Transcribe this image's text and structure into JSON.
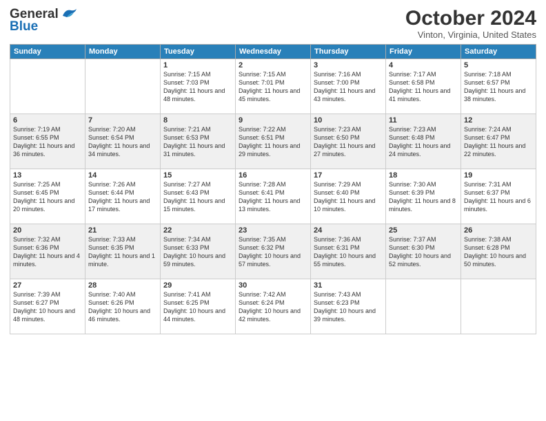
{
  "header": {
    "logo": {
      "general": "General",
      "blue": "Blue"
    },
    "title": "October 2024",
    "location": "Vinton, Virginia, United States"
  },
  "days_of_week": [
    "Sunday",
    "Monday",
    "Tuesday",
    "Wednesday",
    "Thursday",
    "Friday",
    "Saturday"
  ],
  "weeks": [
    [
      {
        "day": "",
        "info": ""
      },
      {
        "day": "",
        "info": ""
      },
      {
        "day": "1",
        "info": "Sunrise: 7:15 AM\nSunset: 7:03 PM\nDaylight: 11 hours\nand 48 minutes."
      },
      {
        "day": "2",
        "info": "Sunrise: 7:15 AM\nSunset: 7:01 PM\nDaylight: 11 hours\nand 45 minutes."
      },
      {
        "day": "3",
        "info": "Sunrise: 7:16 AM\nSunset: 7:00 PM\nDaylight: 11 hours\nand 43 minutes."
      },
      {
        "day": "4",
        "info": "Sunrise: 7:17 AM\nSunset: 6:58 PM\nDaylight: 11 hours\nand 41 minutes."
      },
      {
        "day": "5",
        "info": "Sunrise: 7:18 AM\nSunset: 6:57 PM\nDaylight: 11 hours\nand 38 minutes."
      }
    ],
    [
      {
        "day": "6",
        "info": "Sunrise: 7:19 AM\nSunset: 6:55 PM\nDaylight: 11 hours\nand 36 minutes."
      },
      {
        "day": "7",
        "info": "Sunrise: 7:20 AM\nSunset: 6:54 PM\nDaylight: 11 hours\nand 34 minutes."
      },
      {
        "day": "8",
        "info": "Sunrise: 7:21 AM\nSunset: 6:53 PM\nDaylight: 11 hours\nand 31 minutes."
      },
      {
        "day": "9",
        "info": "Sunrise: 7:22 AM\nSunset: 6:51 PM\nDaylight: 11 hours\nand 29 minutes."
      },
      {
        "day": "10",
        "info": "Sunrise: 7:23 AM\nSunset: 6:50 PM\nDaylight: 11 hours\nand 27 minutes."
      },
      {
        "day": "11",
        "info": "Sunrise: 7:23 AM\nSunset: 6:48 PM\nDaylight: 11 hours\nand 24 minutes."
      },
      {
        "day": "12",
        "info": "Sunrise: 7:24 AM\nSunset: 6:47 PM\nDaylight: 11 hours\nand 22 minutes."
      }
    ],
    [
      {
        "day": "13",
        "info": "Sunrise: 7:25 AM\nSunset: 6:45 PM\nDaylight: 11 hours\nand 20 minutes."
      },
      {
        "day": "14",
        "info": "Sunrise: 7:26 AM\nSunset: 6:44 PM\nDaylight: 11 hours\nand 17 minutes."
      },
      {
        "day": "15",
        "info": "Sunrise: 7:27 AM\nSunset: 6:43 PM\nDaylight: 11 hours\nand 15 minutes."
      },
      {
        "day": "16",
        "info": "Sunrise: 7:28 AM\nSunset: 6:41 PM\nDaylight: 11 hours\nand 13 minutes."
      },
      {
        "day": "17",
        "info": "Sunrise: 7:29 AM\nSunset: 6:40 PM\nDaylight: 11 hours\nand 10 minutes."
      },
      {
        "day": "18",
        "info": "Sunrise: 7:30 AM\nSunset: 6:39 PM\nDaylight: 11 hours\nand 8 minutes."
      },
      {
        "day": "19",
        "info": "Sunrise: 7:31 AM\nSunset: 6:37 PM\nDaylight: 11 hours\nand 6 minutes."
      }
    ],
    [
      {
        "day": "20",
        "info": "Sunrise: 7:32 AM\nSunset: 6:36 PM\nDaylight: 11 hours\nand 4 minutes."
      },
      {
        "day": "21",
        "info": "Sunrise: 7:33 AM\nSunset: 6:35 PM\nDaylight: 11 hours\nand 1 minute."
      },
      {
        "day": "22",
        "info": "Sunrise: 7:34 AM\nSunset: 6:33 PM\nDaylight: 10 hours\nand 59 minutes."
      },
      {
        "day": "23",
        "info": "Sunrise: 7:35 AM\nSunset: 6:32 PM\nDaylight: 10 hours\nand 57 minutes."
      },
      {
        "day": "24",
        "info": "Sunrise: 7:36 AM\nSunset: 6:31 PM\nDaylight: 10 hours\nand 55 minutes."
      },
      {
        "day": "25",
        "info": "Sunrise: 7:37 AM\nSunset: 6:30 PM\nDaylight: 10 hours\nand 52 minutes."
      },
      {
        "day": "26",
        "info": "Sunrise: 7:38 AM\nSunset: 6:28 PM\nDaylight: 10 hours\nand 50 minutes."
      }
    ],
    [
      {
        "day": "27",
        "info": "Sunrise: 7:39 AM\nSunset: 6:27 PM\nDaylight: 10 hours\nand 48 minutes."
      },
      {
        "day": "28",
        "info": "Sunrise: 7:40 AM\nSunset: 6:26 PM\nDaylight: 10 hours\nand 46 minutes."
      },
      {
        "day": "29",
        "info": "Sunrise: 7:41 AM\nSunset: 6:25 PM\nDaylight: 10 hours\nand 44 minutes."
      },
      {
        "day": "30",
        "info": "Sunrise: 7:42 AM\nSunset: 6:24 PM\nDaylight: 10 hours\nand 42 minutes."
      },
      {
        "day": "31",
        "info": "Sunrise: 7:43 AM\nSunset: 6:23 PM\nDaylight: 10 hours\nand 39 minutes."
      },
      {
        "day": "",
        "info": ""
      },
      {
        "day": "",
        "info": ""
      }
    ]
  ]
}
